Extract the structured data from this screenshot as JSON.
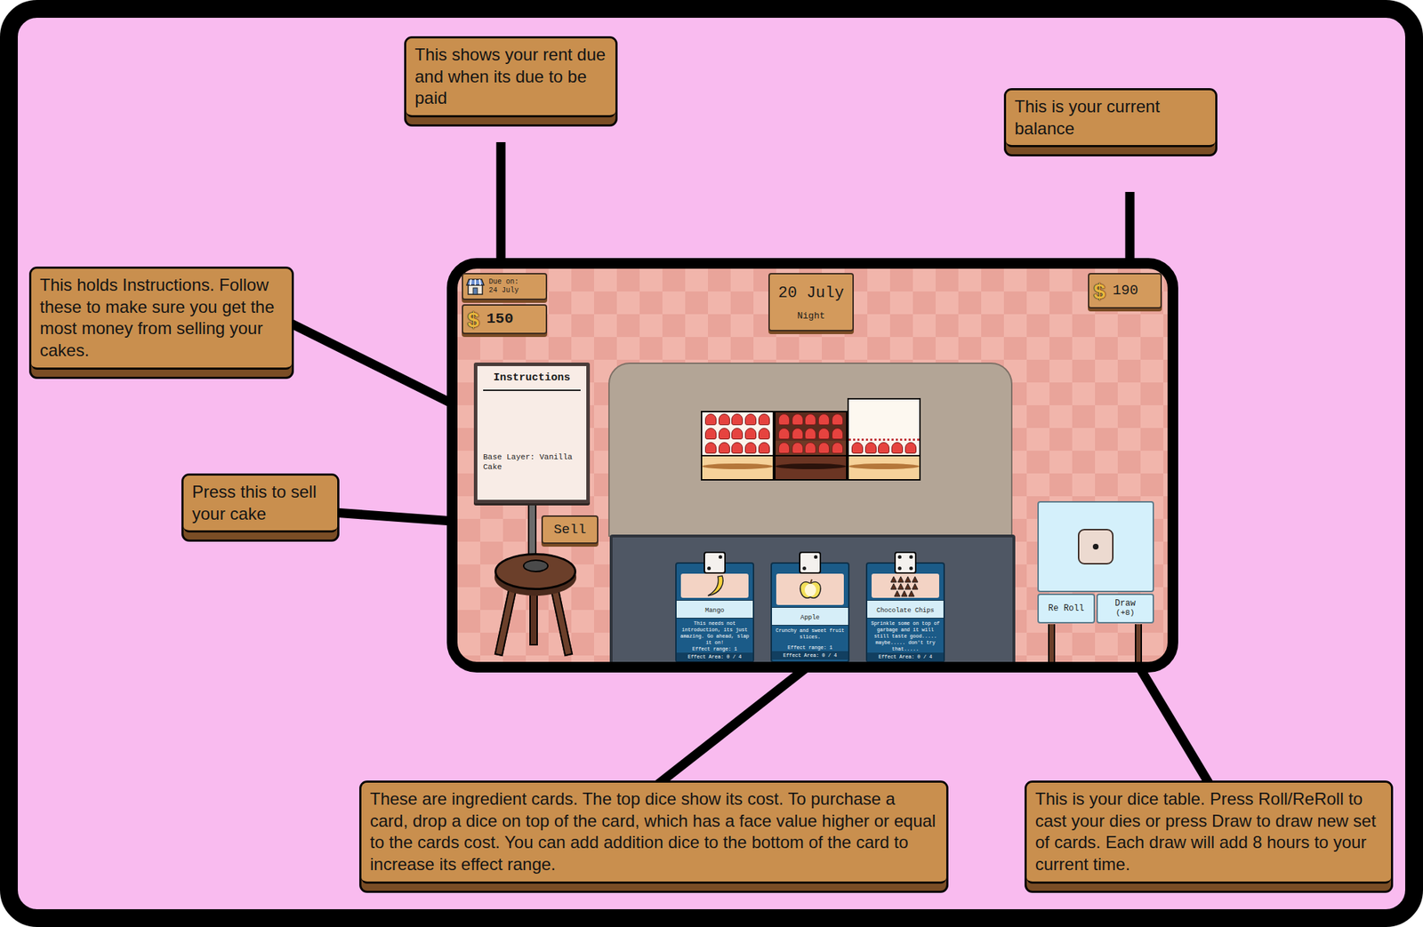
{
  "callouts": [
    {
      "text": "This shows your rent due and when its due to be paid"
    },
    {
      "text": "This is your current balance"
    },
    {
      "text": "This holds Instructions. Follow these to make sure you get the most money from selling your cakes."
    },
    {
      "text": "Press this to sell your cake"
    },
    {
      "text": "These are ingredient cards. The top dice show its cost. To purchase a card, drop a dice on top of the card, which has a face value higher or equal to the cards cost. You can add addition dice to the bottom of the card to increase its effect range."
    },
    {
      "text": "This is your dice table. Press Roll/ReRoll to cast your dies or press Draw to draw new set of cards. Each draw will add 8 hours to your current time."
    }
  ],
  "game": {
    "rent": {
      "due_label": "Due on:",
      "due_date": "24 July",
      "currency": "$",
      "amount": "150"
    },
    "date": {
      "day": "20 July",
      "time": "Night"
    },
    "balance": {
      "currency": "$",
      "amount": "190"
    },
    "instructions": {
      "title": "Instructions",
      "lines": [
        "Base Layer: Vanilla Cake"
      ]
    },
    "sell_button": "Sell",
    "cakes": [
      {
        "kind": "strawberry"
      },
      {
        "kind": "chocolate"
      },
      {
        "kind": "frosted"
      }
    ],
    "cards": [
      {
        "name": "Mango",
        "cost": 2,
        "description": "This needs not introduction, its just amazing. Go ahead, slap it on!",
        "range": "Effect range: 1",
        "area": "Effect Area: 0 / 4"
      },
      {
        "name": "Apple",
        "cost": 2,
        "description": "Crunchy and sweet fruit slices.",
        "range": "Effect range: 1",
        "area": "Effect Area: 0 / 4"
      },
      {
        "name": "Chocolate Chips",
        "cost": 4,
        "description": "Sprinkle some on top of garbage and it will still taste good..... maybe..... don't try that.....",
        "area": "Effect Area: 0 / 4"
      }
    ],
    "dice_table": {
      "die": 1,
      "buttons": [
        {
          "label": "Re Roll"
        },
        {
          "label": "Draw",
          "sub": "(+8)"
        }
      ]
    }
  }
}
